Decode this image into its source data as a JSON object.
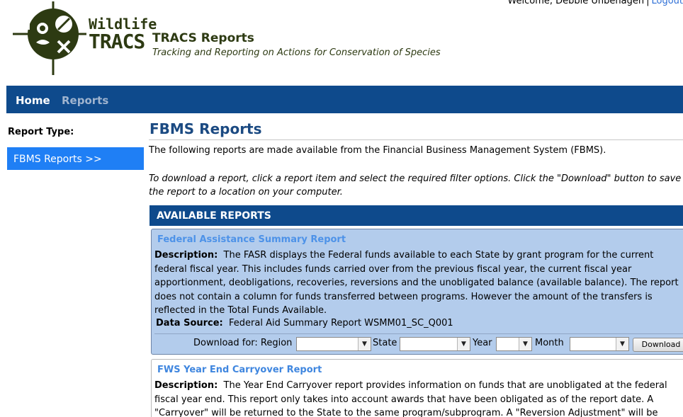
{
  "header": {
    "welcome_text": "Welcome, Debbie Unbehagen",
    "separator": "|",
    "logout_label": "Logout",
    "logo_word1": "Wildlife",
    "logo_word2": "TRACS",
    "app_title": "TRACS Reports",
    "app_subtitle": "Tracking and Reporting on Actions for Conservation of Species",
    "logo_icon": "wildlife-crosshair-logo"
  },
  "nav": {
    "items": [
      {
        "label": "Home"
      },
      {
        "label": "Reports"
      }
    ]
  },
  "sidebar": {
    "label": "Report Type:",
    "items": [
      {
        "label": "FBMS Reports  >>"
      }
    ]
  },
  "main": {
    "title": "FBMS Reports",
    "intro": "The following reports are made available from the Financial Business Management System (FBMS).",
    "instructions": "To download a report, click a report item and select the required filter options. Click the \"Download\" button to save the report to a location on your computer.",
    "section_header": "AVAILABLE REPORTS",
    "reports": [
      {
        "title": "Federal Assistance Summary Report",
        "description_label": "Description:",
        "description": "The FASR displays the Federal funds available to each State by grant program for the current federal fiscal year. This includes funds carried over from the previous fiscal year, the current fiscal year apportionment, deobligations, recoveries, reversions and the unobligated balance (available balance). The report does not contain a column for funds transferred between programs. However the amount of the transfers is reflected in the Total Funds Available.",
        "source_label": "Data Source:",
        "source": "Federal Aid Summary Report WSMM01_SC_Q001",
        "filters": {
          "download_for": "Download for: Region",
          "state": "State",
          "year": "Year",
          "month": "Month",
          "region_value": "",
          "state_value": "",
          "year_value": "",
          "month_value": ""
        },
        "download_label": "Download"
      },
      {
        "title": "FWS Year End Carryover Report",
        "description_label": "Description:",
        "description": "The Year End Carryover report provides information on funds that are unobligated at the federal fiscal year end. This report only takes into account awards that have been obligated as of the report date. A \"Carryover\" will be returned to the State to the same program/subprogram. A \"Reversion Adjustment\" will be"
      }
    ]
  },
  "colors": {
    "nav_bg": "#0e4a8c",
    "sidebar_active": "#1f7ff5",
    "report_highlight": "#b3ccec",
    "title_blue": "#1b4a82",
    "link_blue": "#4d92e8"
  }
}
